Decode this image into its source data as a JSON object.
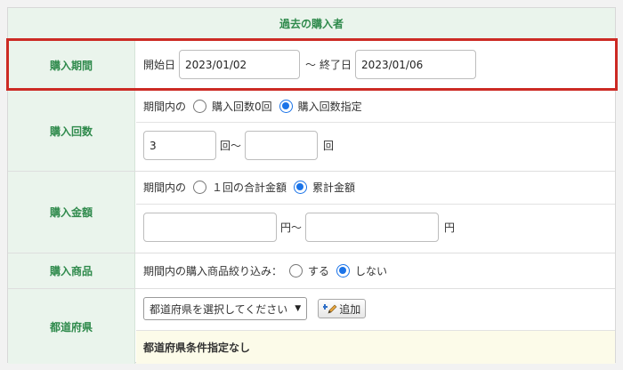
{
  "caption": "過去の購入者",
  "period": {
    "label": "購入期間",
    "start_label": "開始日",
    "start_value": "2023/01/02",
    "separator": "～",
    "end_label": "終了日",
    "end_value": "2023/01/06"
  },
  "count": {
    "label": "購入回数",
    "prefix": "期間内の",
    "option_zero": "購入回数0回",
    "option_specified": "購入回数指定",
    "selected": "option_specified",
    "min_value": "3",
    "max_value": "",
    "unit": "回",
    "range_sep": "回～"
  },
  "amount": {
    "label": "購入金額",
    "prefix": "期間内の",
    "option_single": "１回の合計金額",
    "option_cumulative": "累計金額",
    "selected": "option_cumulative",
    "min_value": "",
    "max_value": "",
    "unit": "円",
    "range_sep": "円～"
  },
  "product": {
    "label": "購入商品",
    "prefix": "期間内の購入商品絞り込み：",
    "option_yes": "する",
    "option_no": "しない",
    "selected": "option_no"
  },
  "prefecture": {
    "label": "都道府県",
    "select_value": "都道府県を選択してください",
    "add_button": "追加",
    "note": "都道府県条件指定なし"
  },
  "colors": {
    "header_bg": "#eaf4ec",
    "header_text": "#2f8a4c",
    "radio_accent": "#1a73e8",
    "highlight": "#cc2a24",
    "note_bg": "#fcfbe9"
  }
}
